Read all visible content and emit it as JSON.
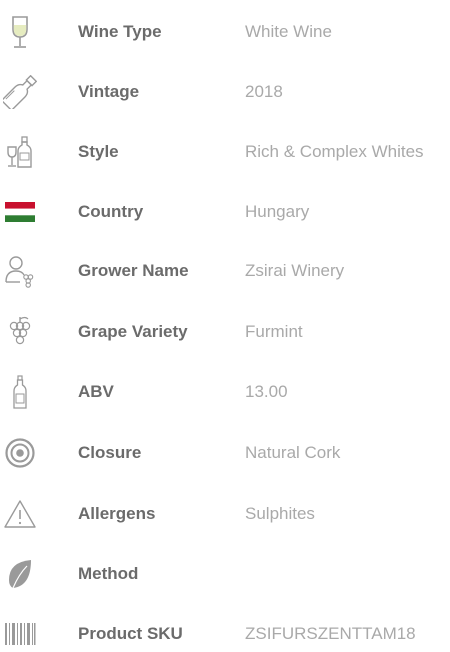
{
  "colors": {
    "label": "#6b6b6b",
    "value": "#a9a9a9",
    "icon": "#9a9a9a",
    "wine_fill": "#e6ecc0",
    "flag_red": "#c8102e",
    "flag_white": "#ffffff",
    "flag_green": "#2e7d32"
  },
  "specs": [
    {
      "icon": "wine-glass-icon",
      "label": "Wine Type",
      "value": "White Wine"
    },
    {
      "icon": "bottle-icon",
      "label": "Vintage",
      "value": "2018"
    },
    {
      "icon": "glass-and-bottle-icon",
      "label": "Style",
      "value": "Rich & Complex Whites"
    },
    {
      "icon": "hungary-flag-icon",
      "label": "Country",
      "value": "Hungary"
    },
    {
      "icon": "grower-icon",
      "label": "Grower Name",
      "value": "Zsirai Winery"
    },
    {
      "icon": "grapes-icon",
      "label": "Grape Variety",
      "value": "Furmint"
    },
    {
      "icon": "small-bottle-icon",
      "label": "ABV",
      "value": "13.00"
    },
    {
      "icon": "cork-icon",
      "label": "Closure",
      "value": "Natural Cork"
    },
    {
      "icon": "warning-icon",
      "label": "Allergens",
      "value": "Sulphites"
    },
    {
      "icon": "leaf-icon",
      "label": "Method",
      "value": ""
    },
    {
      "icon": "barcode-icon",
      "label": "Product SKU",
      "value": "ZSIFURSZENTTAM18"
    }
  ]
}
